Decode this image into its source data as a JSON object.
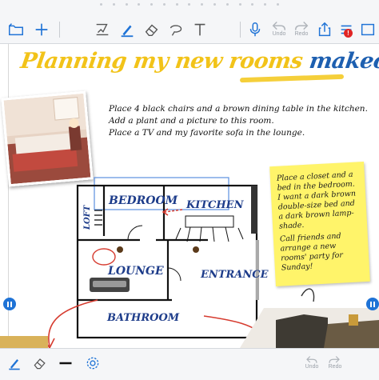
{
  "toolbar": {
    "undo_label": "Undo",
    "redo_label": "Redo",
    "icons": [
      "folder-icon",
      "plus-icon",
      "lasso-icon",
      "pen-icon",
      "eraser-icon",
      "shape-icon",
      "text-icon",
      "microphone-icon",
      "undo-icon",
      "redo-icon",
      "share-icon",
      "menu-icon"
    ],
    "notification_count": "!",
    "accent": "#1f73d6",
    "badge_color": "#e02424"
  },
  "page": {
    "title_main": "Planning my new rooms",
    "title_accent": "makeover!",
    "note_lines": [
      "Place 4 black chairs and a brown dining table in the kitchen.",
      "Add a plant and a picture to this room.",
      "Place a TV and my favorite sofa in the lounge."
    ],
    "sticky": {
      "paragraph_1": "Place a closet and a bed in the bedroom. I want a dark brown double-size bed and a dark brown lamp-shade.",
      "paragraph_2": "Call friends and arrange a new rooms' party for Sunday!",
      "color": "#fff46a"
    },
    "floorplan": {
      "rooms": {
        "bedroom": "BEDROOM",
        "kitchen": "KITCHEN",
        "loft": "LOFT",
        "lounge": "LOUNGE",
        "entrance": "ENTRANCE",
        "bathroom": "BATHROOM"
      }
    }
  },
  "bottom_toolbar": {
    "undo_label": "Undo",
    "redo_label": "Redo",
    "icons": [
      "pen-icon",
      "eraser-icon",
      "line-width-icon",
      "settings-icon",
      "undo-icon",
      "redo-icon"
    ]
  }
}
